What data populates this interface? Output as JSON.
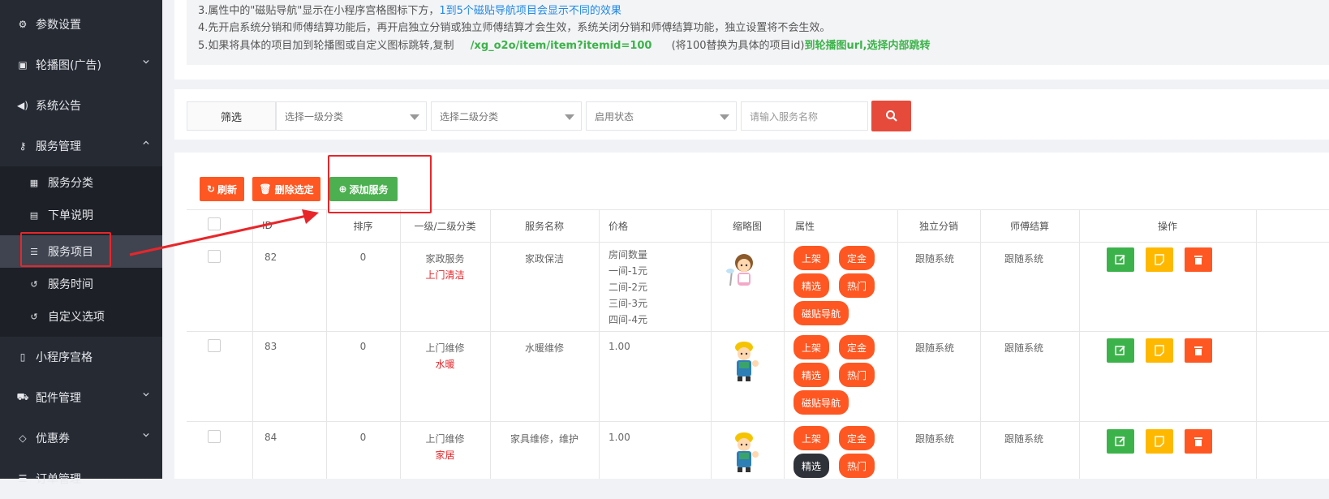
{
  "sidebar": {
    "items": [
      {
        "label": "参数设置",
        "icon": "gear-icon",
        "has_chevron": false
      },
      {
        "label": "轮播图(广告)",
        "icon": "image-icon",
        "has_chevron": true
      },
      {
        "label": "系统公告",
        "icon": "volume-icon",
        "has_chevron": false
      },
      {
        "label": "服务管理",
        "icon": "key-icon",
        "has_chevron": true,
        "expanded": true
      },
      {
        "label": "小程序宫格",
        "icon": "mobile-icon",
        "has_chevron": false
      },
      {
        "label": "配件管理",
        "icon": "cart-icon",
        "has_chevron": true
      },
      {
        "label": "优惠券",
        "icon": "diamond-icon",
        "has_chevron": true
      },
      {
        "label": "订单管理",
        "icon": "list-icon",
        "has_chevron": false
      }
    ],
    "subitems": [
      {
        "label": "服务分类",
        "icon": "grid-icon"
      },
      {
        "label": "下单说明",
        "icon": "file-icon"
      },
      {
        "label": "服务项目",
        "icon": "list-icon",
        "active": true
      },
      {
        "label": "服务时间",
        "icon": "history-icon"
      },
      {
        "label": "自定义选项",
        "icon": "history-icon"
      }
    ]
  },
  "notes": {
    "line3_prefix": "3.属性中的\"磁贴导航\"显示在小程序宫格图标下方，",
    "line3_blue": "1到5个磁贴导航项目会显示不同的效果",
    "line4": "4.先开启系统分销和师傅结算功能后，再开启独立分销或独立师傅结算才会生效，系统关闭分销和师傅结算功能，独立设置将不会生效。",
    "line5_prefix": "5.如果将具体的项目加到轮播图或自定义图标跳转,复制",
    "line5_path": "/xg_o2o/item/item?itemid=100",
    "line5_mid": "(将100替换为具体的项目id)",
    "line5_green": "到轮播图url,选择内部跳转"
  },
  "filter": {
    "label": "筛选",
    "select1": "选择一级分类",
    "select2": "选择二级分类",
    "select3": "启用状态",
    "search_placeholder": "请输入服务名称"
  },
  "toolbar": {
    "refresh": "刷新",
    "delete": "删除选定",
    "add": "添加服务"
  },
  "table": {
    "headers": [
      "",
      "ID",
      "排序",
      "一级/二级分类",
      "服务名称",
      "价格",
      "缩略图",
      "属性",
      "独立分销",
      "师傅结算",
      "操作"
    ],
    "rows": [
      {
        "id": "82",
        "sort": "0",
        "cat1": "家政服务",
        "cat2": "上门清洁",
        "name": "家政保洁",
        "price": [
          "房间数量",
          "一间-1元",
          "二间-2元",
          "三间-3元",
          "四间-4元"
        ],
        "tags": [
          "上架",
          "定金",
          "精选",
          "热门",
          "磁贴导航"
        ],
        "dist": "跟随系统",
        "settle": "跟随系统"
      },
      {
        "id": "83",
        "sort": "0",
        "cat1": "上门维修",
        "cat2": "水暖",
        "name": "水暖维修",
        "price": [
          "1.00"
        ],
        "tags": [
          "上架",
          "定金",
          "精选",
          "热门",
          "磁贴导航"
        ],
        "dist": "跟随系统",
        "settle": "跟随系统"
      },
      {
        "id": "84",
        "sort": "0",
        "cat1": "上门维修",
        "cat2": "家居",
        "name": "家具维修，维护",
        "price": [
          "1.00"
        ],
        "tags": [
          "上架",
          "定金",
          "精选",
          "热门"
        ],
        "dist": "跟随系统",
        "settle": "跟随系统"
      }
    ]
  },
  "colors": {
    "accent_orange": "#ff5722",
    "accent_green": "#4caf50",
    "accent_yellow": "#ffb800",
    "annotation_red": "#e8262a",
    "sidebar_bg": "#262a33"
  }
}
